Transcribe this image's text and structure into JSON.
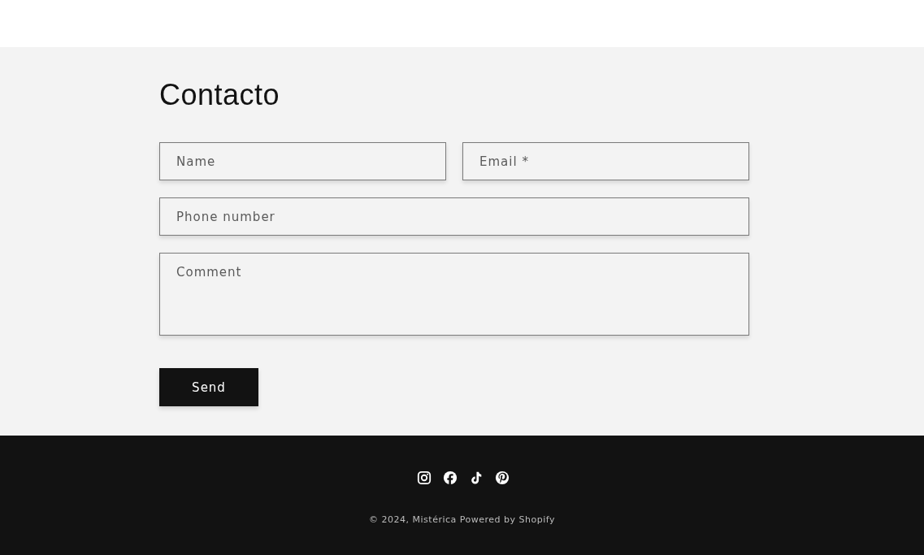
{
  "contact": {
    "title": "Contacto",
    "fields": [
      {
        "kind": "half",
        "placeholder": "Name"
      },
      {
        "kind": "half",
        "placeholder": "Email *"
      },
      {
        "kind": "full",
        "placeholder": "Phone number"
      },
      {
        "kind": "area",
        "placeholder": "Comment"
      }
    ],
    "submit": "Send"
  },
  "footer": {
    "copyright": "© 2024,",
    "brand": "Mistérica",
    "powered": "Powered by Shopify"
  }
}
